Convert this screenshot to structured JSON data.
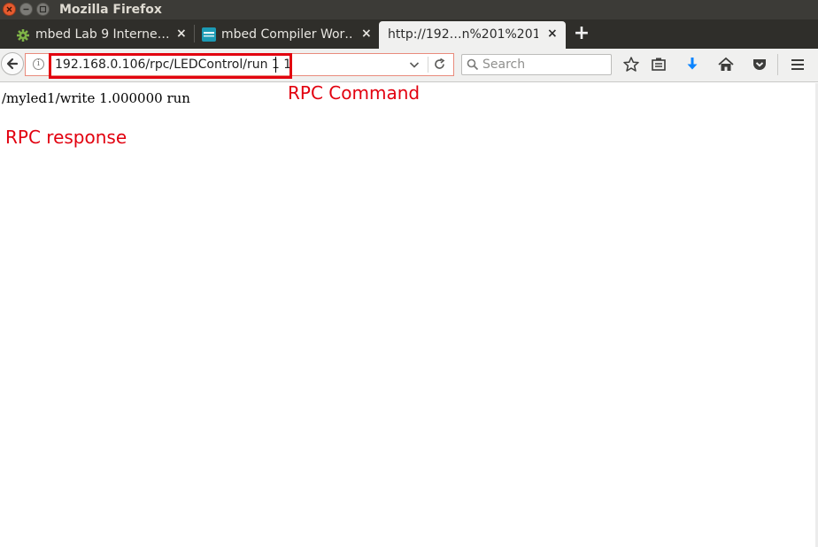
{
  "window": {
    "title": "Mozilla Firefox"
  },
  "tabs": [
    {
      "label": "mbed Lab 9 Interne…",
      "icon": "gear-icon",
      "active": false
    },
    {
      "label": "mbed Compiler Wor…",
      "icon": "arm-mbed-icon",
      "active": false
    },
    {
      "label": "http://192…n%201%201",
      "icon": "",
      "active": true
    }
  ],
  "tab_close_glyph": "×",
  "new_tab_glyph": "+",
  "navbar": {
    "url": "192.168.0.106/rpc/LEDControl/run 1 1",
    "search_placeholder": "Search",
    "info_glyph": "i"
  },
  "toolbar_icons": [
    "bookmark-star-icon",
    "reading-list-icon",
    "download-icon",
    "home-icon",
    "pocket-icon",
    "menu-icon"
  ],
  "colors": {
    "annotation": "#e2000f",
    "download": "#0a84ff"
  },
  "page": {
    "response_text": "/myled1/write 1.000000 run"
  },
  "annotations": {
    "command_label": "RPC Command",
    "response_label": "RPC response"
  }
}
